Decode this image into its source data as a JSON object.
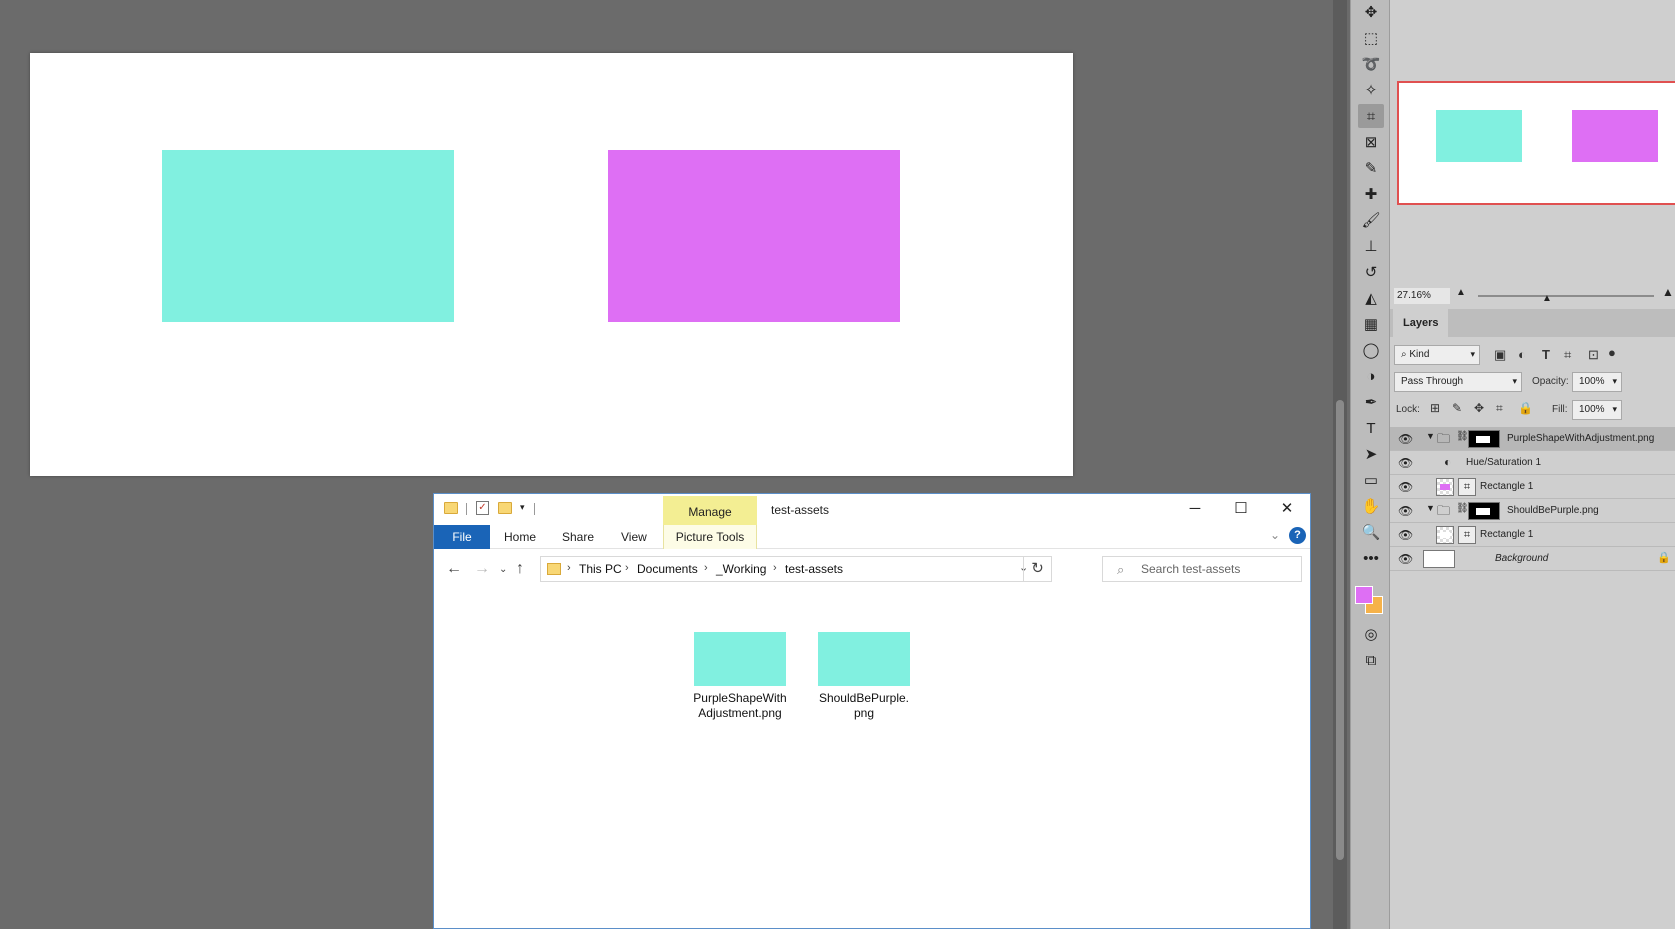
{
  "colors": {
    "teal": "#81f0e0",
    "purple": "#de6ff4",
    "ps_background": "#6b6b6b",
    "foreground_swatch": "#de6ff4",
    "background_swatch": "#f6b24a",
    "explorer_accent": "#1a64b7",
    "manage_tab": "#f3ee93"
  },
  "photoshop": {
    "navigator": {
      "zoom": "27.16%"
    },
    "layers_panel": {
      "tab_label": "Layers",
      "filter": "Kind",
      "blend_mode": "Pass Through",
      "opacity_label": "Opacity:",
      "opacity": "100%",
      "lock_label": "Lock:",
      "fill_label": "Fill:",
      "fill": "100%",
      "layers": [
        {
          "name": "PurpleShapeWithAdjustment.png",
          "kind": "group",
          "selected": true
        },
        {
          "name": "Hue/Saturation 1",
          "kind": "adjustment"
        },
        {
          "name": "Rectangle 1",
          "kind": "shape",
          "thumb_color": "#de6ff4"
        },
        {
          "name": "ShouldBePurple.png",
          "kind": "group"
        },
        {
          "name": "Rectangle 1",
          "kind": "shape",
          "thumb_color": "#ffffff"
        },
        {
          "name": "Background",
          "kind": "background",
          "locked": true
        }
      ]
    },
    "tools": [
      "move-icon",
      "marquee-icon",
      "lasso-icon",
      "magic-wand-icon",
      "crop-icon",
      "frame-icon",
      "eyedropper-icon",
      "healing-brush-icon",
      "brush-icon",
      "clone-stamp-icon",
      "history-brush-icon",
      "eraser-icon",
      "gradient-icon",
      "blur-icon",
      "dodge-icon",
      "pen-icon",
      "type-icon",
      "path-selection-icon",
      "rectangle-icon",
      "hand-icon",
      "zoom-icon",
      "more-icon"
    ]
  },
  "explorer": {
    "title": "test-assets",
    "manage_tab": "Manage",
    "tabs": {
      "file": "File",
      "home": "Home",
      "share": "Share",
      "view": "View",
      "picture_tools": "Picture Tools"
    },
    "breadcrumb": [
      "This PC",
      "Documents",
      "_Working",
      "test-assets"
    ],
    "search_placeholder": "Search test-assets",
    "files": [
      {
        "name_line1": "PurpleShapeWith",
        "name_line2": "Adjustment.png",
        "thumb_color": "#81f0e0"
      },
      {
        "name_line1": "ShouldBePurple.",
        "name_line2": "png",
        "thumb_color": "#81f0e0"
      }
    ]
  }
}
